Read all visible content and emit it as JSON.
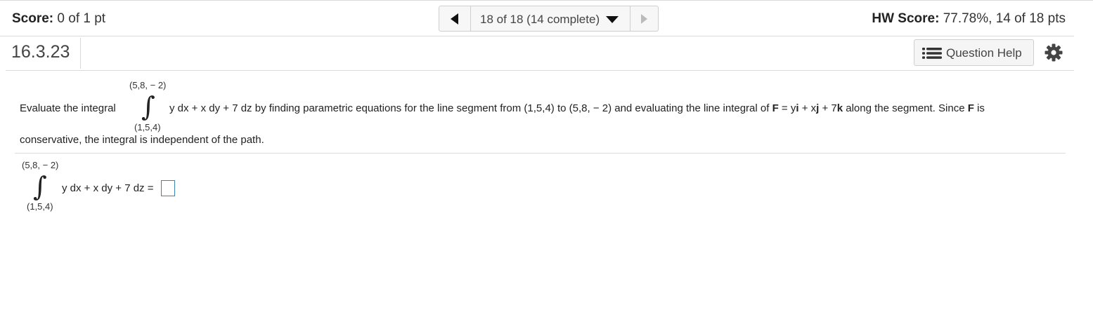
{
  "header": {
    "score_label": "Score:",
    "score_value": "0 of 1 pt",
    "nav_position": "18 of 18 (14 complete)",
    "hw_score_label": "HW Score:",
    "hw_score_value": "77.78%, 14 of 18 pts"
  },
  "question": {
    "number": "16.3.23",
    "help_label": "Question Help"
  },
  "problem": {
    "intro": "Evaluate the integral",
    "upper_limit": "(5,8, − 2)",
    "lower_limit": "(1,5,4)",
    "line1_a": "y dx + x dy + 7 dz by finding parametric equations for the line segment from (1,5,4) to (5,8, − 2) and evaluating the line integral of ",
    "F": "F",
    "line1_b": " = y",
    "i": "i",
    "line1_c": " + x",
    "j": "j",
    "line1_d": " + 7",
    "k": "k",
    "line1_e": " along the segment.  Since ",
    "F2": "F",
    "line1_f": " is",
    "line2": "conservative, the integral is independent of the path."
  },
  "answer": {
    "upper_limit": "(5,8, − 2)",
    "lower_limit": "(1,5,4)",
    "integrand": "y dx + x dy + 7 dz ="
  },
  "icons": [
    "prev-triangle-icon",
    "dropdown-caret-icon",
    "next-triangle-icon",
    "list-icon",
    "gear-icon",
    "integral-icon"
  ],
  "colors": {
    "answer_box_border": "#3a86b0",
    "divider": "#d9d9d9"
  }
}
